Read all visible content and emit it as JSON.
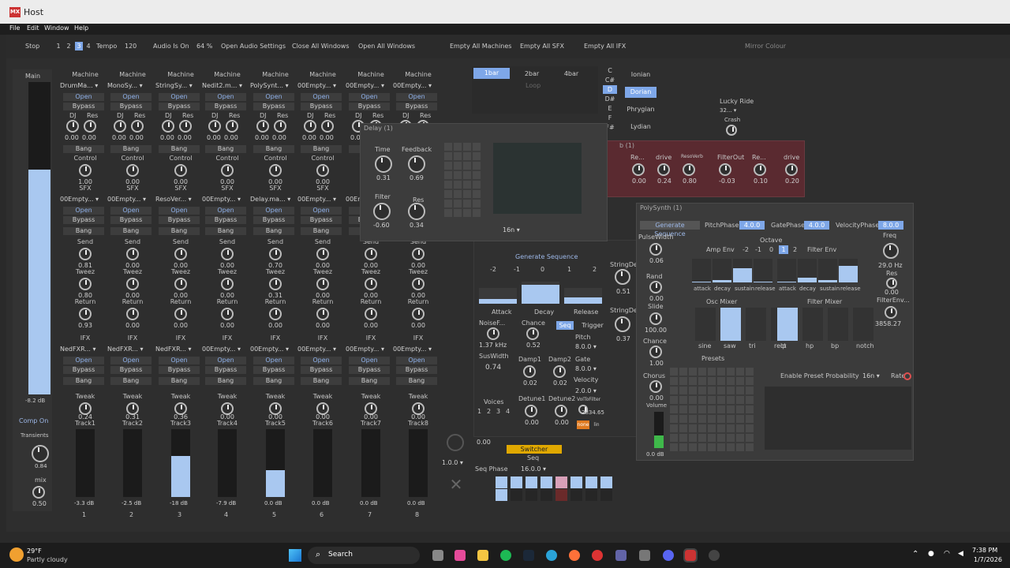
{
  "window": {
    "title": "Host"
  },
  "menu": [
    "File",
    "Edit",
    "Window",
    "Help"
  ],
  "toolbar": {
    "stop": "Stop",
    "nums": [
      "1",
      "2",
      "3",
      "4"
    ],
    "tempo_label": "Tempo",
    "tempo_value": "120",
    "audio_status": "Audio Is On",
    "cpu": "64 %",
    "open_audio": "Open Audio Settings",
    "close_all": "Close All Windows",
    "open_all": "Open All Windows",
    "empty_machines": "Empty All Machines",
    "empty_sfx": "Empty All SFX",
    "empty_ifx": "Empty All IFX",
    "mirror_colour": "Mirror Colour"
  },
  "main_strip": {
    "label": "Main",
    "db": "-8.2 dB",
    "comp": "Comp On",
    "transients": "Transients",
    "transients_val": "0.84",
    "mix": "mix",
    "mix_val": "0.50"
  },
  "tracks": [
    {
      "machine": "DrumMa...",
      "dj": "0.00",
      "res": "0.00",
      "control": "1.00",
      "sfx": "00Empty...",
      "send": "0.81",
      "tweez": "0.80",
      "ret": "0.93",
      "ifx": "NedFXR...",
      "tweak": "0.24",
      "name": "Track1",
      "db": "-3.3 dB",
      "num": "1"
    },
    {
      "machine": "MonoSy...",
      "dj": "0.00",
      "res": "0.00",
      "control": "0.00",
      "sfx": "00Empty...",
      "send": "0.00",
      "tweez": "0.00",
      "ret": "0.00",
      "ifx": "NedFXR...",
      "tweak": "0.31",
      "name": "Track2",
      "db": "-2.5 dB",
      "num": "2"
    },
    {
      "machine": "StringSy...",
      "dj": "0.00",
      "res": "0.00",
      "control": "0.00",
      "sfx": "ResoVer...",
      "send": "0.00",
      "tweez": "0.00",
      "ret": "0.00",
      "ifx": "NedFXR...",
      "tweak": "0.36",
      "name": "Track3",
      "db": "-18 dB",
      "num": "3"
    },
    {
      "machine": "Nedit2.m...",
      "dj": "0.00",
      "res": "0.00",
      "control": "0.00",
      "sfx": "00Empty...",
      "send": "0.00",
      "tweez": "0.00",
      "ret": "0.00",
      "ifx": "00Empty...",
      "tweak": "0.00",
      "name": "Track4",
      "db": "-7.9 dB",
      "num": "4"
    },
    {
      "machine": "PolySynt...",
      "dj": "0.00",
      "res": "0.00",
      "control": "0.00",
      "sfx": "Delay.ma...",
      "send": "0.70",
      "tweez": "0.31",
      "ret": "0.00",
      "ifx": "00Empty...",
      "tweak": "0.00",
      "name": "Track5",
      "db": "0.0 dB",
      "num": "5"
    },
    {
      "machine": "00Empty...",
      "dj": "0.00",
      "res": "0.00",
      "control": "0.00",
      "sfx": "00Empty...",
      "send": "0.00",
      "tweez": "0.00",
      "ret": "0.00",
      "ifx": "00Empty...",
      "tweak": "0.00",
      "name": "Track6",
      "db": "0.0 dB",
      "num": "6"
    },
    {
      "machine": "00Empty...",
      "dj": "0.00",
      "res": "0.00",
      "control": "0.00",
      "sfx": "00Empty...",
      "send": "0.00",
      "tweez": "0.00",
      "ret": "0.00",
      "ifx": "00Empty...",
      "tweak": "0.00",
      "name": "Track7",
      "db": "0.0 dB",
      "num": "7"
    },
    {
      "machine": "00Empty...",
      "dj": "0.00",
      "res": "0.00",
      "control": "0.00",
      "sfx": "00Empty...",
      "send": "0.00",
      "tweez": "0.00",
      "ret": "0.00",
      "ifx": "00Empty...",
      "tweak": "0.00",
      "name": "Track8",
      "db": "0.0 dB",
      "num": "8"
    }
  ],
  "labels": {
    "machine": "Machine",
    "open": "Open",
    "bypass": "Bypass",
    "dj": "DJ",
    "res": "Res",
    "bang": "Bang",
    "control": "Control",
    "sfx": "SFX",
    "send": "Send",
    "tweez": "Tweez",
    "ret": "Return",
    "ifx": "IFX",
    "tweak": "Tweak"
  },
  "levels": [
    0,
    0,
    0.6,
    0,
    0.4,
    0,
    0,
    0
  ],
  "delay": {
    "title": "Delay (1)",
    "time": "Time",
    "time_val": "0.31",
    "feedback": "Feedback",
    "fb_val": "0.69",
    "filter": "Filter",
    "filter_val": "-0.60",
    "res": "Res",
    "res_val": "0.34",
    "rate": "16n"
  },
  "bars": {
    "b1": "1bar",
    "b2": "2bar",
    "b4": "4bar",
    "loop": "Loop"
  },
  "notes": [
    "C",
    "C#",
    "D",
    "D#",
    "E",
    "F",
    "F#"
  ],
  "modes": [
    "Ionian",
    "Dorian",
    "Phrygian",
    "Lydian"
  ],
  "lucky": {
    "title": "Lucky Ride",
    "val": "32...",
    "crash": "Crash"
  },
  "reso": {
    "title": "b (1)",
    "labels": [
      "Re...",
      "drive",
      "ResoVerb",
      "FilterOut",
      "Re...",
      "drive"
    ],
    "vals": [
      "0.00",
      "0.24",
      "0.80",
      "-0.03",
      "0.10",
      "0.20"
    ]
  },
  "gen_seq": {
    "title": "Generate Sequence",
    "steps": [
      "-2",
      "-1",
      "0",
      "1",
      "2"
    ],
    "attack": "Attack",
    "decay": "Decay",
    "release": "Release",
    "noise": "NoiseF...",
    "noise_val": "1.37 kHz",
    "chance": "Chance",
    "chance_val": "0.52",
    "seq": "Seq",
    "trigger": "Trigger",
    "pitch": "Pitch",
    "pitch_val": "8.0.0",
    "gate": "Gate",
    "gate_val": "8.0.0",
    "suswidth": "SusWidth",
    "sus_val": "0.74",
    "damp1": "Damp1",
    "damp1_val": "0.02",
    "damp2": "Damp2",
    "damp2_val": "0.02",
    "velocity": "Velocity",
    "vel_val": "2.0.0",
    "voices": "Voices",
    "voice_nums": [
      "1",
      "2",
      "3",
      "4"
    ],
    "detune1": "Detune1",
    "detune1_val": "0.00",
    "detune2": "Detune2",
    "detune2_val": "0.00",
    "voltofilter": "VolToFilter",
    "vtf_val": "2834.65",
    "none": "none",
    "lin": "lin",
    "stringdec": "StringDec",
    "sd1": "0.51",
    "sd2": "0.37",
    "sixteen": "16n"
  },
  "switcher": {
    "val1": "0.00",
    "val2": "1.0.0",
    "label": "Switcher",
    "seq": "Seq",
    "phase": "Seq Phase",
    "phase_val": "16.0.0"
  },
  "poly": {
    "title": "PolySynth (1)",
    "gen": "Generate Sequence",
    "pitchphase": "PitchPhase",
    "pp_val": "4.0.0",
    "gatephase": "GatePhase",
    "gp_val": "4.0.0",
    "velphase": "VelocityPhase",
    "vp_val": "8.0.0",
    "pulsewidth": "PulseWidth",
    "pw_val": "0.06",
    "octave": "Octave",
    "oct_vals": [
      "-2",
      "-1",
      "0",
      "1",
      "2"
    ],
    "ampenv": "Amp Env",
    "filterenv": "Filter Env",
    "freq": "Freq",
    "freq_val": "29.0 Hz",
    "res": "Res",
    "res_val": "0.00",
    "rand": "Rand",
    "rand_val": "0.00",
    "env_labels": [
      "attack",
      "decay",
      "sustain",
      "release"
    ],
    "oscmixer": "Osc Mixer",
    "filtermixer": "Filter Mixer",
    "filterenv_amt": "FilterEnv...",
    "fe_val": "3858.27",
    "slide": "Slide",
    "slide_val": "100.00",
    "osc": [
      "sine",
      "saw",
      "tri",
      "rect"
    ],
    "flt": [
      "lp",
      "hp",
      "bp",
      "notch"
    ],
    "chance": "Chance",
    "chance_val": "1.00",
    "presets": "Presets",
    "chorus": "Chorus",
    "chorus_val": "0.00",
    "volume": "Volume",
    "vol_val": "0.0 dB",
    "enable": "Enable Preset Probability",
    "rate_sel": "16n",
    "rate": "Rate"
  },
  "taskbar": {
    "temp": "29°F",
    "weather": "Partly cloudy",
    "search": "Search",
    "time": "7:38 PM",
    "date": "1/7/2026"
  }
}
